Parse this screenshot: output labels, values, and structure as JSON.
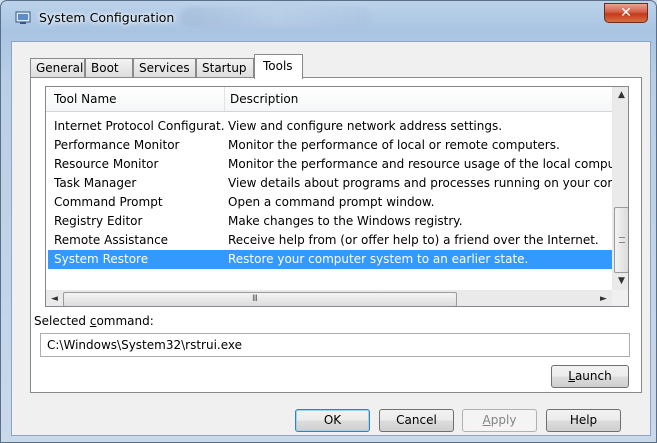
{
  "window": {
    "title": "System Configuration",
    "close_glyph": "✕",
    "app_icon": "msconfig-icon"
  },
  "tabs": [
    {
      "label": "General"
    },
    {
      "label": "Boot"
    },
    {
      "label": "Services"
    },
    {
      "label": "Startup"
    },
    {
      "label": "Tools",
      "active": true
    }
  ],
  "list": {
    "columns": [
      "Tool Name",
      "Description"
    ],
    "rows": [
      {
        "name": "Internet Protocol Configurat...",
        "description": "View and configure network address settings."
      },
      {
        "name": "Performance Monitor",
        "description": "Monitor the performance of local or remote computers."
      },
      {
        "name": "Resource Monitor",
        "description": "Monitor the performance and resource usage of the local computer."
      },
      {
        "name": "Task Manager",
        "description": "View details about programs and processes running on your computer."
      },
      {
        "name": "Command Prompt",
        "description": "Open a command prompt window."
      },
      {
        "name": "Registry Editor",
        "description": "Make changes to the Windows registry."
      },
      {
        "name": "Remote Assistance",
        "description": "Receive help from (or offer help to) a friend over the Internet."
      },
      {
        "name": "System Restore",
        "description": "Restore your computer system to an earlier state.",
        "selected": true
      }
    ],
    "scroll_up": "▲",
    "scroll_down": "▼",
    "scroll_left": "◄",
    "scroll_right": "►",
    "hgrip": "III",
    "selected_color": "#3399ff"
  },
  "selected_command": {
    "label_prefix": "Selected ",
    "label_accel": "c",
    "label_suffix": "ommand:",
    "value": "C:\\Windows\\System32\\rstrui.exe"
  },
  "buttons": {
    "launch_accel": "L",
    "launch_rest": "aunch",
    "ok": "OK",
    "cancel": "Cancel",
    "apply_accel": "A",
    "apply_rest": "pply",
    "help": "Help"
  }
}
